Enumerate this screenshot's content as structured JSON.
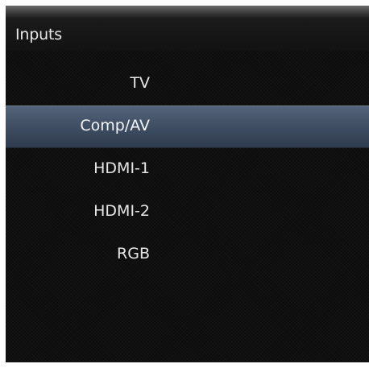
{
  "window": {
    "title": "Inputs"
  },
  "inputs": [
    {
      "label": "TV",
      "selected": false
    },
    {
      "label": "Comp/AV",
      "selected": true
    },
    {
      "label": "HDMI-1",
      "selected": false
    },
    {
      "label": "HDMI-2",
      "selected": false
    },
    {
      "label": "RGB",
      "selected": false
    }
  ],
  "colors": {
    "background": "#0d0d0d",
    "highlight": "#3f4e63",
    "text": "#e6e6e6"
  }
}
